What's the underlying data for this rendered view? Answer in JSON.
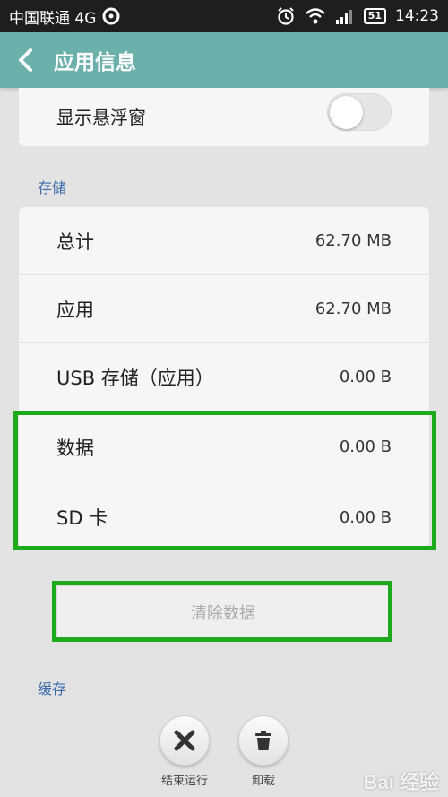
{
  "status_bar": {
    "carrier": "中国联通 4G",
    "battery": "51",
    "time": "14:23"
  },
  "header": {
    "title": "应用信息"
  },
  "floating_window": {
    "label": "显示悬浮窗",
    "enabled": false
  },
  "storage": {
    "section_title": "存储",
    "rows": [
      {
        "label": "总计",
        "value": "62.70 MB"
      },
      {
        "label": "应用",
        "value": "62.70 MB"
      },
      {
        "label": "USB 存储（应用）",
        "value": "0.00 B"
      },
      {
        "label": "数据",
        "value": "0.00 B"
      },
      {
        "label": "SD 卡",
        "value": "0.00 B"
      }
    ],
    "clear_button": "清除数据"
  },
  "cache": {
    "section_title": "缓存"
  },
  "actions": {
    "force_stop": "结束运行",
    "uninstall": "卸载"
  },
  "watermark": "Bai 经验",
  "colors": {
    "header": "#6cb0ab",
    "highlight": "#1daa1d",
    "section_title": "#3b6bab"
  }
}
